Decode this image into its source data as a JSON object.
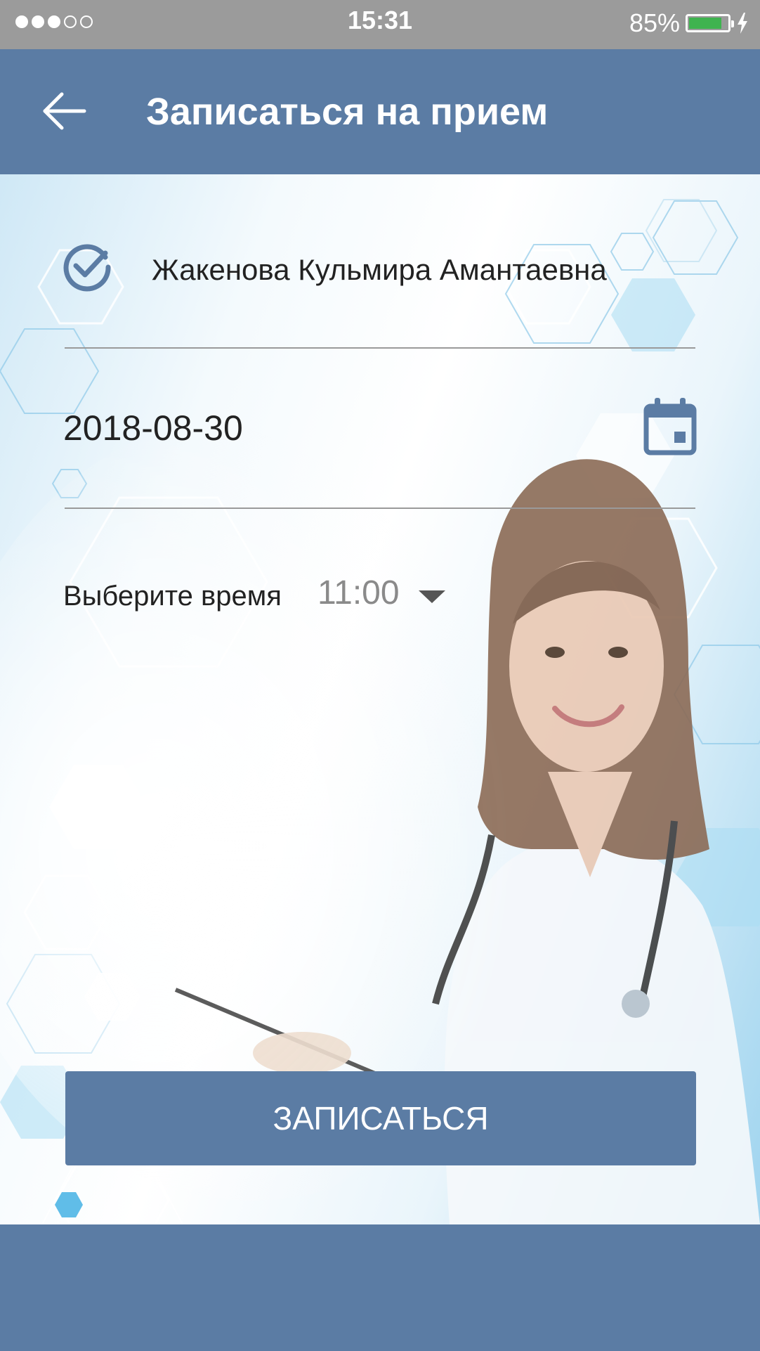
{
  "status_bar": {
    "signal_filled": 3,
    "signal_total": 5,
    "time": "15:31",
    "battery_percent_label": "85%",
    "battery_level": 0.85,
    "battery_color": "#3fb34f",
    "charge_icon": "lightning-icon"
  },
  "header": {
    "back_icon": "arrow-left-icon",
    "title": "Записаться на прием",
    "background_color": "#5b7ca4"
  },
  "form": {
    "doctor_icon": "check-circle-icon",
    "doctor_name": "Жакенова Кульмира Амантаевна",
    "date": "2018-08-30",
    "date_icon": "calendar-icon",
    "time_label": "Выберите время",
    "time_value": "11:00",
    "time_dropdown_icon": "caret-down-icon"
  },
  "actions": {
    "submit_label": "ЗАПИСАТЬСЯ"
  },
  "colors": {
    "accent": "#5b7ca4",
    "status_bar": "#9b9b9b"
  }
}
